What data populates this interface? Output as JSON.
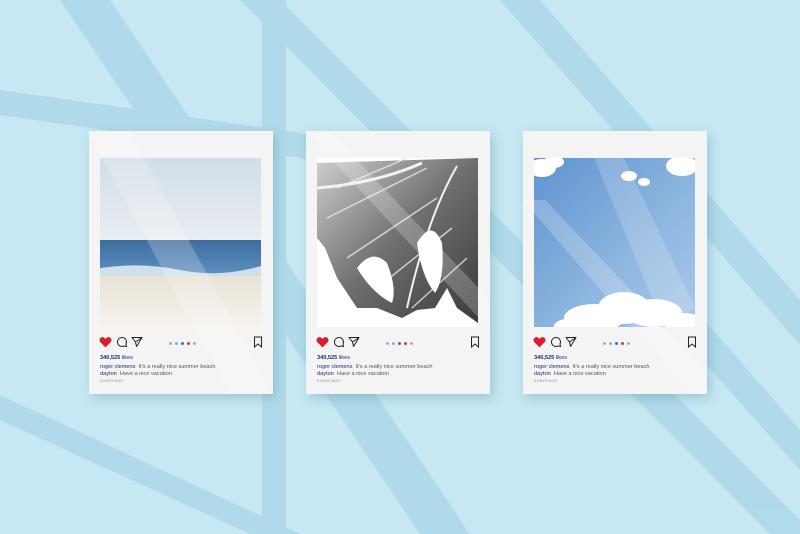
{
  "scene": {
    "background_color": "#c5e8f3",
    "accent_heart_color": "#d81e2a",
    "username_color": "#1d2b6b"
  },
  "cards": [
    {
      "image": "beach-photo",
      "likes_count": "340,525",
      "likes_word": "likes",
      "caption_user_1": "roger clemens",
      "caption_text_1": "It's a really nice summer beach",
      "caption_user_2": "dayton",
      "caption_text_2": "Have a nice vacation",
      "timestamp": "5 DAYS AGO"
    },
    {
      "image": "monstera-leaf-photo",
      "likes_count": "340,525",
      "likes_word": "likes",
      "caption_user_1": "roger clemens",
      "caption_text_1": "It's a really nice summer beach",
      "caption_user_2": "dayton",
      "caption_text_2": "Have a nice vacation",
      "timestamp": "5 DAYS AGO"
    },
    {
      "image": "sky-clouds-photo",
      "likes_count": "340,525",
      "likes_word": "likes",
      "caption_user_1": "roger clemens",
      "caption_text_1": "It's a really nice summer beach",
      "caption_user_2": "dayton",
      "caption_text_2": "Have a nice vacation",
      "timestamp": "5 DAYS AGO"
    }
  ],
  "icons": [
    "heart-icon",
    "comment-icon",
    "share-icon",
    "carousel-dots",
    "bookmark-icon"
  ]
}
